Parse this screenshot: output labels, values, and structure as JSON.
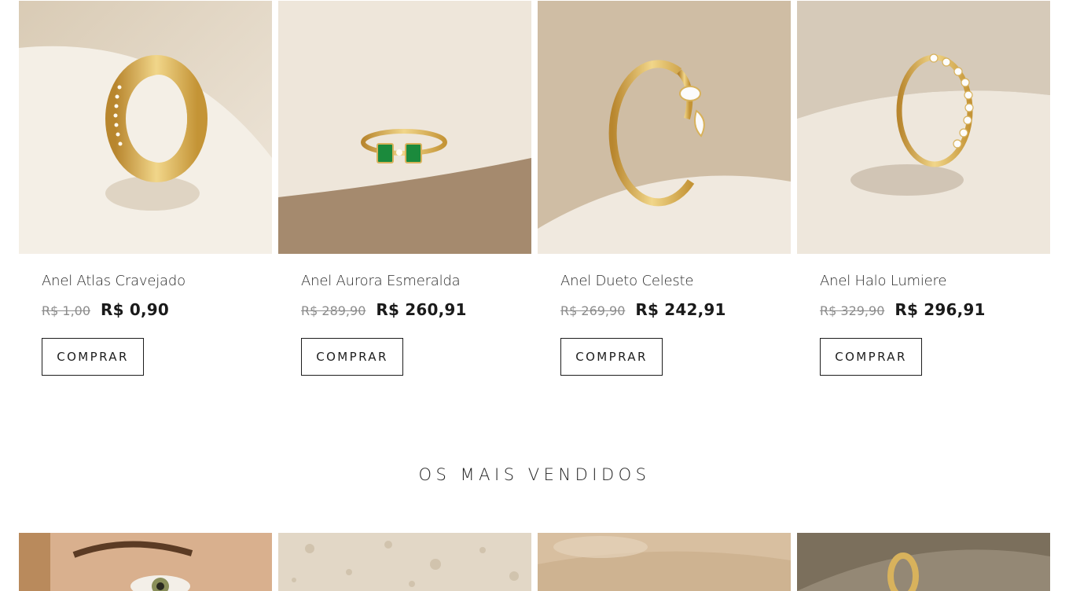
{
  "products": [
    {
      "name": "Anel Atlas Cravejado",
      "old_price": "R$ 1,00",
      "price": "R$ 0,90",
      "button": "COMPRAR",
      "image_icon": "gold-ring-band-icon"
    },
    {
      "name": "Anel Aurora Esmeralda",
      "old_price": "R$ 289,90",
      "price": "R$ 260,91",
      "button": "COMPRAR",
      "image_icon": "emerald-ring-icon"
    },
    {
      "name": "Anel Dueto Celeste",
      "old_price": "R$ 269,90",
      "price": "R$ 242,91",
      "button": "COMPRAR",
      "image_icon": "open-ring-diamonds-icon"
    },
    {
      "name": "Anel Halo Lumiere",
      "old_price": "R$ 329,90",
      "price": "R$ 296,91",
      "button": "COMPRAR",
      "image_icon": "eternity-ring-icon"
    }
  ],
  "best_sellers": {
    "title": "OS MAIS VENDIDOS"
  },
  "colors": {
    "gold": "#d8b25c",
    "emerald": "#1b8a3c",
    "text": "#1d1d1d",
    "muted": "#8c8c8c"
  }
}
